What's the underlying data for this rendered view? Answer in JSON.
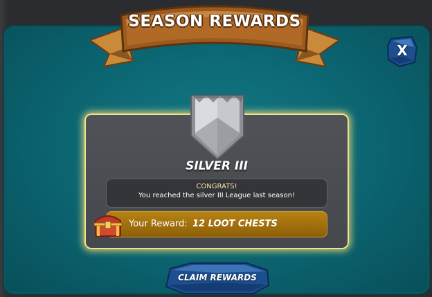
{
  "banner": {
    "title": "SEASON REWARDS"
  },
  "close_button": {
    "label": "X"
  },
  "league": {
    "name": "SILVER III",
    "congrats_title": "CONGRATS!",
    "congrats_text": "You reached the silver III League last season!",
    "badge_icon": "silver-league-shield-icon"
  },
  "reward": {
    "label": "Your Reward:",
    "value": "12 LOOT CHESTS",
    "icon": "loot-chest-icon"
  },
  "claim_button": {
    "label": "CLAIM REWARDS"
  },
  "colors": {
    "modal_teal": "#0b6470",
    "panel_glow": "#f2e08c",
    "reward_gold": "#b58212",
    "ribbon_brown": "#8b4d18",
    "button_blue": "#1c4a8a"
  }
}
